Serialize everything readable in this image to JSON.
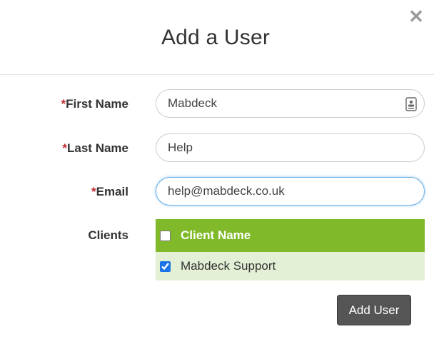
{
  "modal": {
    "title": "Add a User",
    "close_glyph": "✕"
  },
  "form": {
    "required_mark": "*",
    "first_name": {
      "label": "First Name",
      "value": "Mabdeck"
    },
    "last_name": {
      "label": "Last Name",
      "value": "Help"
    },
    "email": {
      "label": "Email",
      "value": "help@mabdeck.co.uk"
    },
    "clients": {
      "label": "Clients",
      "header": "Client Name",
      "header_checked": false,
      "rows": [
        {
          "name": "Mabdeck Support",
          "checked": true
        }
      ]
    },
    "submit_label": "Add User"
  },
  "icons": {
    "close": "close-icon",
    "contact_card": "contact-card-icon"
  },
  "colors": {
    "table_header": "#80b929",
    "table_row": "#e4f0d6",
    "required": "#c0282d",
    "button": "#555555"
  }
}
